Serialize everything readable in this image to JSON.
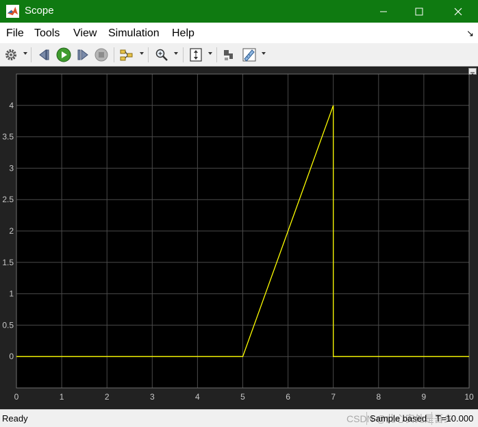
{
  "window": {
    "title": "Scope",
    "titlebar_color": "#0f7a11"
  },
  "menu": {
    "items": [
      "File",
      "Tools",
      "View",
      "Simulation",
      "Help"
    ]
  },
  "toolbar": {
    "icons": [
      "gear-icon",
      "step-back-icon",
      "run-icon",
      "step-forward-icon",
      "stop-icon",
      "signal-selector-icon",
      "zoom-in-icon",
      "fit-axes-icon",
      "highlight-block-icon",
      "measurement-icon"
    ]
  },
  "status": {
    "ready": "Ready",
    "sample_mode": "Sample based",
    "time": "T=10.000",
    "watermark": "CSDN @此心安处是吾乡"
  },
  "chart_data": {
    "type": "line",
    "title": "",
    "xlabel": "",
    "ylabel": "",
    "xlim": [
      0,
      10
    ],
    "ylim": [
      -0.5,
      4.5
    ],
    "xticks": [
      0,
      1,
      2,
      3,
      4,
      5,
      6,
      7,
      8,
      9,
      10
    ],
    "yticks": [
      0,
      0.5,
      1,
      1.5,
      2,
      2.5,
      3,
      3.5,
      4
    ],
    "ytick_labels": [
      "0",
      "0.5",
      "1",
      "1.5",
      "2",
      "2.5",
      "3",
      "3.5",
      "4"
    ],
    "grid": true,
    "background": "#000000",
    "line_color": "#ffff00",
    "series": [
      {
        "x": [
          0,
          5,
          7,
          7,
          10
        ],
        "y": [
          0,
          0,
          4,
          0,
          0
        ]
      }
    ]
  }
}
